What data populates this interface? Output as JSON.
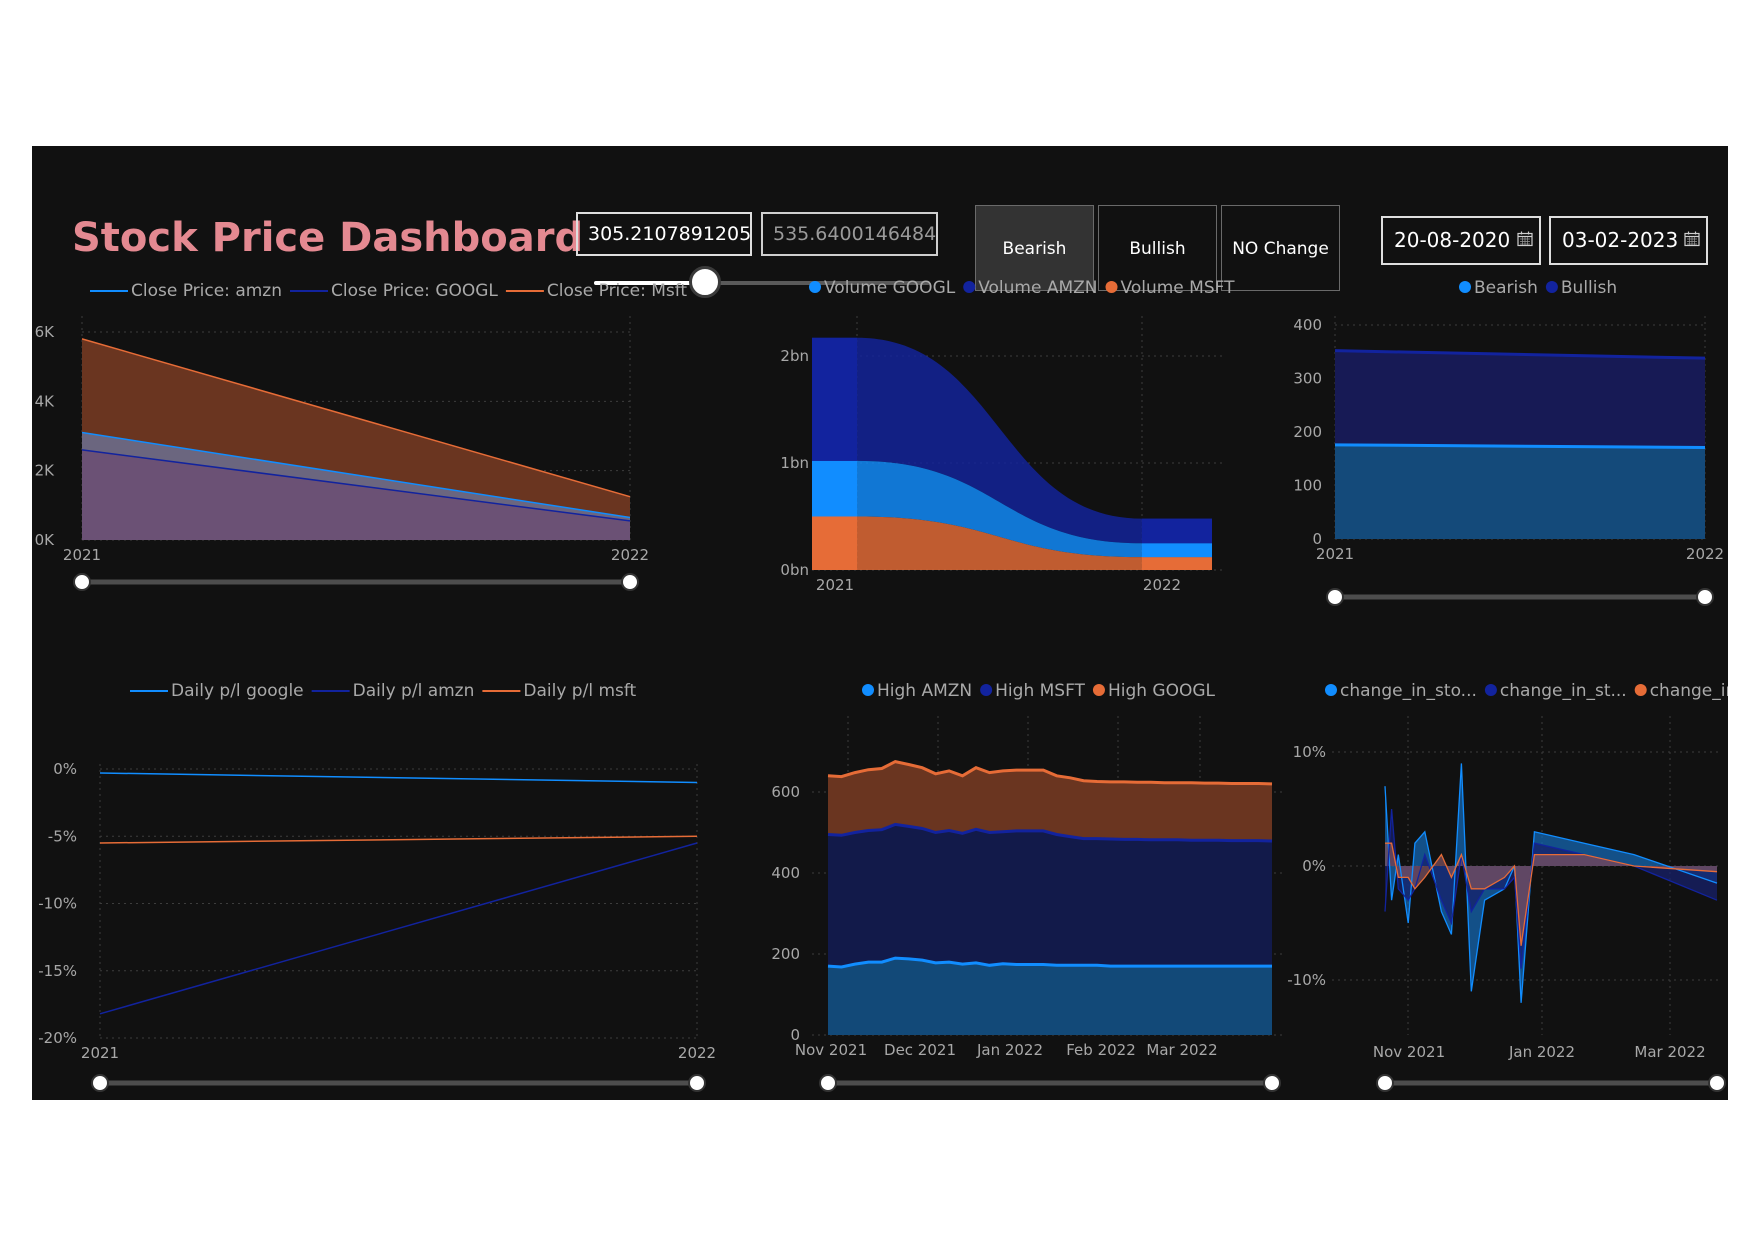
{
  "dashboard": {
    "title": "Stock Price Dashboard",
    "value_range": {
      "min_text": "305.2107891205",
      "max_text": "535.6400146484",
      "slider_level": 0.33
    },
    "trend_buttons": [
      {
        "label": "Bearish",
        "selected": true
      },
      {
        "label": "Bullish",
        "selected": false
      },
      {
        "label": "NO Change",
        "selected": false
      }
    ],
    "date_range": {
      "start": "20-08-2020",
      "end": "03-02-2023",
      "icon": "calendar-icon"
    },
    "colors": {
      "background": "#111111",
      "title": "#e48991",
      "light_blue": "#118dff",
      "dark_blue": "#12239e",
      "orange": "#e66c37"
    }
  },
  "chart_data": [
    {
      "id": "close-price",
      "type": "area",
      "legend": [
        "Close Price: amzn",
        "Close Price: GOOGL",
        "Close Price: Msft"
      ],
      "categories": [
        "2021",
        "2022"
      ],
      "series": [
        {
          "name": "Close Price: amzn",
          "values": [
            3100,
            650
          ]
        },
        {
          "name": "Close Price: GOOGL",
          "values": [
            2600,
            550
          ]
        },
        {
          "name": "Close Price: Msft",
          "values": [
            5800,
            1250
          ]
        }
      ],
      "y_ticks": [
        "0K",
        "2K",
        "4K",
        "6K"
      ],
      "ylim": [
        0,
        6000
      ],
      "grid": true
    },
    {
      "id": "volume",
      "type": "area",
      "legend": [
        "Volume GOOGL",
        "Volume AMZN",
        "Volume MSFT"
      ],
      "categories": [
        "2021",
        "2022"
      ],
      "series": [
        {
          "name": "Volume GOOGL",
          "values": [
            1000000000,
            120000000
          ]
        },
        {
          "name": "Volume AMZN",
          "values": [
            2200000000,
            500000000
          ]
        },
        {
          "name": "Volume MSFT",
          "values": [
            500000000,
            260000000
          ]
        }
      ],
      "y_ticks": [
        "0bn",
        "1bn",
        "2bn"
      ],
      "ylim": [
        0,
        2400000000
      ],
      "grid": true
    },
    {
      "id": "bearish-bullish",
      "type": "area",
      "legend": [
        "Bearish",
        "Bullish"
      ],
      "categories": [
        "2021",
        "2022"
      ],
      "series": [
        {
          "name": "Bearish",
          "values": [
            176,
            171
          ]
        },
        {
          "name": "Bullish",
          "values": [
            352,
            338
          ]
        }
      ],
      "y_ticks": [
        "0",
        "100",
        "200",
        "300",
        "400"
      ],
      "ylim": [
        0,
        400
      ],
      "grid": true
    },
    {
      "id": "daily-pl",
      "type": "line",
      "legend": [
        "Daily p/l google",
        "Daily p/l amzn",
        "Daily p/l msft"
      ],
      "categories": [
        "2021",
        "2022"
      ],
      "series": [
        {
          "name": "Daily p/l google",
          "values": [
            -0.3,
            -1.0
          ]
        },
        {
          "name": "Daily p/l amzn",
          "values": [
            -18.2,
            -5.5
          ]
        },
        {
          "name": "Daily p/l msft",
          "values": [
            -5.5,
            -5.0
          ]
        }
      ],
      "y_ticks": [
        "0%",
        "-5%",
        "-10%",
        "-15%",
        "-20%"
      ],
      "ylim": [
        -20,
        0
      ],
      "grid": true
    },
    {
      "id": "high",
      "type": "area",
      "legend": [
        "High AMZN",
        "High MSFT",
        "High GOOGL"
      ],
      "x_ticks": [
        "Nov 2021",
        "Dec 2021",
        "Jan 2022",
        "Feb 2022",
        "Mar 2022"
      ],
      "x_start": "2021-11-01",
      "series": [
        {
          "name": "High AMZN",
          "values": [
            170,
            168,
            175,
            180,
            180,
            190,
            188,
            185,
            178,
            180,
            175,
            178,
            172,
            176,
            174,
            174,
            174,
            172,
            172,
            172,
            172,
            170,
            170,
            170,
            170,
            170,
            170,
            170,
            170,
            170,
            170,
            170,
            170,
            170
          ]
        },
        {
          "name": "High MSFT",
          "values": [
            495,
            493,
            500,
            505,
            507,
            520,
            515,
            510,
            500,
            505,
            498,
            508,
            500,
            502,
            504,
            504,
            504,
            495,
            490,
            485,
            485,
            484,
            483,
            483,
            482,
            482,
            482,
            481,
            481,
            481,
            480,
            480,
            480,
            479
          ]
        },
        {
          "name": "High GOOGL",
          "values": [
            640,
            638,
            648,
            655,
            658,
            675,
            668,
            660,
            645,
            652,
            640,
            660,
            648,
            652,
            654,
            654,
            654,
            640,
            635,
            628,
            626,
            625,
            625,
            624,
            624,
            623,
            623,
            623,
            622,
            622,
            621,
            621,
            621,
            620
          ]
        }
      ],
      "y_ticks": [
        "0",
        "200",
        "400",
        "600"
      ],
      "ylim": [
        0,
        700
      ],
      "grid": true
    },
    {
      "id": "change-in-stock",
      "type": "area",
      "legend": [
        "change_in_sto...",
        "change_in_st...",
        "change_in_st..."
      ],
      "x_ticks": [
        "Nov 2021",
        "Jan 2022",
        "Mar 2022"
      ],
      "series": [
        {
          "name": "change_in_sto...",
          "values": [
            7,
            -3,
            1,
            -5,
            2,
            3,
            -4,
            -6,
            9,
            -11,
            -3,
            -2,
            0,
            -12,
            3,
            2,
            1,
            -1.5
          ]
        },
        {
          "name": "change_in_st...",
          "values": [
            -4,
            5,
            -2,
            -3,
            -2,
            1,
            -3,
            -5,
            1,
            -4,
            -2,
            -2,
            -1,
            -9,
            2,
            1,
            0,
            -3
          ]
        },
        {
          "name": "change_in_st...",
          "values": [
            2,
            2,
            -1,
            -1,
            -2,
            -1,
            1,
            -1,
            1,
            -2,
            -2,
            -1,
            0,
            -7,
            1,
            1,
            0,
            -0.5
          ]
        }
      ],
      "y_ticks": [
        "10%",
        "0%",
        "-10%"
      ],
      "ylim": [
        -15,
        10
      ],
      "grid": true
    }
  ]
}
